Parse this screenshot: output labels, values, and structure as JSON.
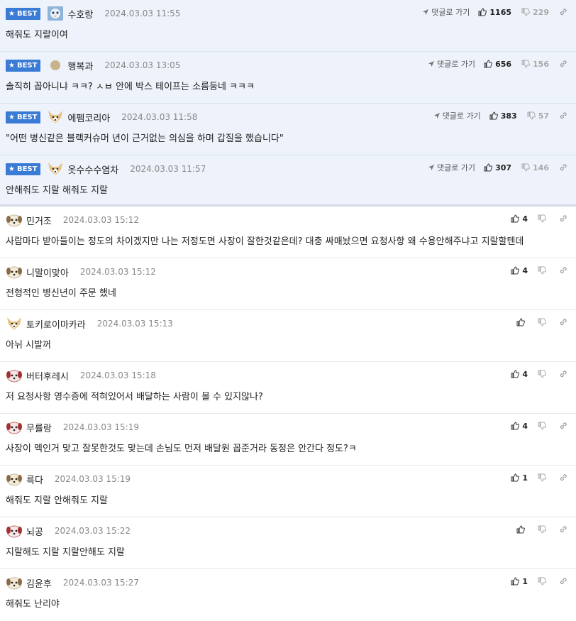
{
  "labels": {
    "best": "BEST",
    "reply": "댓글로 가기"
  },
  "best_comments": [
    {
      "avatar": "blue-bird",
      "nick": "수호랑",
      "date": "2024.03.03 11:55",
      "text": "해줘도 지랄이여",
      "up": "1165",
      "down": "229"
    },
    {
      "avatar": "tan-circle",
      "nick": "행복과",
      "date": "2024.03.03 13:05",
      "text": "솔직히 꼽아니냐 ㅋㅋ? ㅅㅂ 안에 박스 테이프는 소름둥네 ㅋㅋㅋ",
      "up": "656",
      "down": "156"
    },
    {
      "avatar": "fox",
      "nick": "에펨코리아",
      "date": "2024.03.03 11:58",
      "text": "\"어떤 병신같은 블랙커슈머 년이 근거없는 의심을 하며 갑질을 했습니다\"",
      "up": "383",
      "down": "57"
    },
    {
      "avatar": "fox",
      "nick": "옷수수수염차",
      "date": "2024.03.03 11:57",
      "text": "안해줘도 지랄 해줘도 지랄",
      "up": "307",
      "down": "146"
    }
  ],
  "comments": [
    {
      "avatar": "puppy",
      "nick": "민거조",
      "date": "2024.03.03 15:12",
      "text": "사람마다 받아들이는 정도의 차이겠지만 나는 저정도면 사장이 잘한것같은데? 대충 싸매놨으면 요청사항 왜 수용안해주냐고 지랄할텐데",
      "up": "4"
    },
    {
      "avatar": "puppy",
      "nick": "니말이맞아",
      "date": "2024.03.03 15:12",
      "text": "전형적인 병신년이 주문 했네",
      "up": "4"
    },
    {
      "avatar": "fox",
      "nick": "토키로이마카라",
      "date": "2024.03.03 15:13",
      "text": "아뉘 시발꺼",
      "up": ""
    },
    {
      "avatar": "red-puppy",
      "nick": "버터후레시",
      "date": "2024.03.03 15:18",
      "text": "저 요청사항 영수증에 적혀있어서 배달하는 사람이 볼 수 있지않나?",
      "up": "4"
    },
    {
      "avatar": "red-puppy",
      "nick": "무률랑",
      "date": "2024.03.03 15:19",
      "text": "사장이 멕인거 맞고 잘못한것도 맞는데 손님도 먼저 배달원 꼽준거라 동정은 안간다 정도?ㅋ",
      "up": "4"
    },
    {
      "avatar": "puppy",
      "nick": "륵다",
      "date": "2024.03.03 15:19",
      "text": "해줘도 지랄 안해줘도 지랄",
      "up": "1"
    },
    {
      "avatar": "red-puppy",
      "nick": "뇌공",
      "date": "2024.03.03 15:22",
      "text": "지랄해도 지랄 지랄안해도 지랄",
      "up": ""
    },
    {
      "avatar": "puppy",
      "nick": "김윤후",
      "date": "2024.03.03 15:27",
      "text": "해줘도 난리야",
      "up": "1"
    }
  ],
  "colors": {
    "best_bg": "#eef3fb",
    "badge": "#3a7bd5"
  }
}
